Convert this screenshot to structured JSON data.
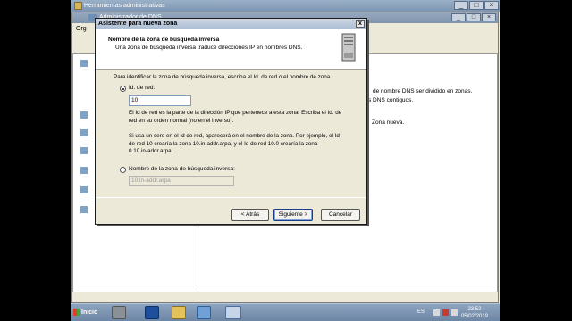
{
  "background_window": {
    "title": "Herramientas administrativas"
  },
  "dns_window": {
    "title": "Administrador de DNS",
    "menu_label": "Org",
    "right_pane_lines": [
      "de nombre DNS ser dividido en zonas.",
      "s DNS contiguos.",
      "Zona nueva."
    ]
  },
  "wizard": {
    "title": "Asistente para nueva zona",
    "close_label": "x",
    "header_title": "Nombre de la zona de búsqueda inversa",
    "header_subtitle": "Una zona de búsqueda inversa traduce direcciones IP en nombres DNS.",
    "intro": "Para identificar la zona de búsqueda inversa, escriba el Id. de red o el nombre de zona.",
    "option_network_id": {
      "label": "Id. de red:",
      "selected": true,
      "value": "10"
    },
    "network_id_help": [
      "El Id de red es la parte de la dirección IP que pertenece a esta zona. Escriba el Id. de",
      "red en su orden normal (no en el inverso)."
    ],
    "zero_help": [
      "Si usa un cero en el Id de red, aparecerá en el nombre de la zona.  Por ejemplo, el Id",
      "de red 10 crearía la zona 10.in-addr.arpa, y el Id de red 10.0 crearía la zona",
      "0.10.in-addr.arpa."
    ],
    "option_zone_name": {
      "label": "Nombre de la zona de búsqueda inversa:",
      "selected": false,
      "value": "10.in-addr.arpa"
    },
    "buttons": {
      "back": "< Atrás",
      "next": "Siguiente >",
      "cancel": "Cancelar"
    }
  },
  "taskbar": {
    "start_label": "Inicio",
    "language": "ES",
    "time": "23:52",
    "date": "05/02/2019"
  }
}
